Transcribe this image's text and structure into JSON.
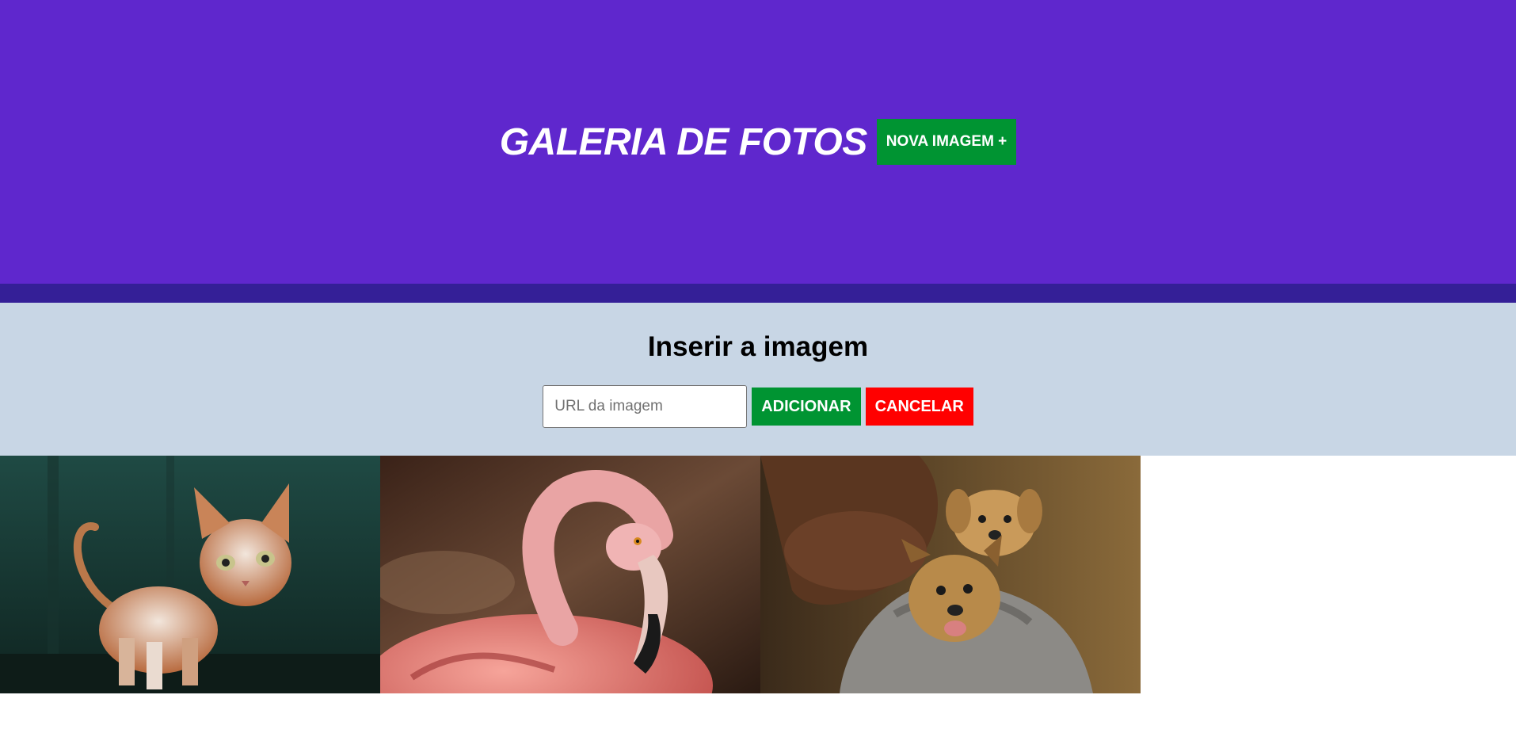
{
  "header": {
    "title": "GALERIA DE FOTOS",
    "new_image_button": "NOVA IMAGEM +"
  },
  "form": {
    "title": "Inserir a imagem",
    "url_placeholder": "URL da imagem",
    "url_value": "",
    "add_button": "ADICIONAR",
    "cancel_button": "CANCELAR"
  },
  "gallery": {
    "photos": [
      {
        "subject": "cat"
      },
      {
        "subject": "flamingo"
      },
      {
        "subject": "puppies"
      }
    ]
  },
  "colors": {
    "header_bg": "#5f27cd",
    "header_band": "#341f97",
    "form_bg": "#c8d6e5",
    "add_green": "#009432",
    "cancel_red": "#ff0000"
  }
}
